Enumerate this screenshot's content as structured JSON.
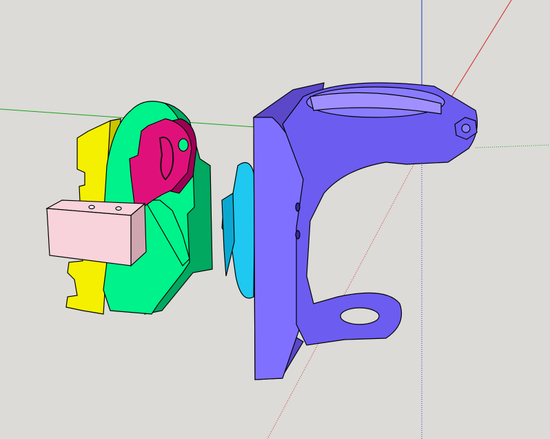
{
  "viewport": {
    "background": "#dcdbd7",
    "axes": {
      "red": "#d42020",
      "green": "#1aa01a",
      "blue": "#2030d0"
    },
    "parts": [
      {
        "name": "yellow-part",
        "color": "#f5f000"
      },
      {
        "name": "green-part",
        "color": "#00f28a"
      },
      {
        "name": "magenta-part",
        "color": "#e0107a"
      },
      {
        "name": "pink-block",
        "color": "#f8d3dc"
      },
      {
        "name": "cyan-part",
        "color": "#1ec8f0"
      },
      {
        "name": "purple-bracket",
        "color": "#8070ff"
      }
    ]
  }
}
